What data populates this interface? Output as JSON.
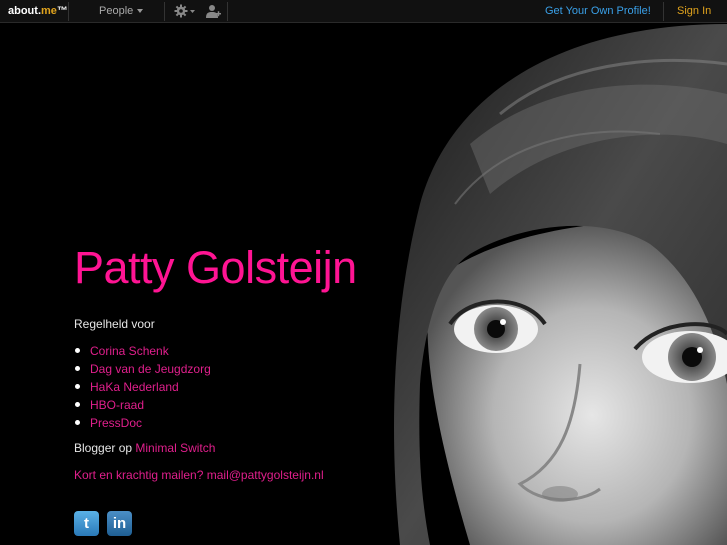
{
  "topbar": {
    "logo_main": "about.",
    "logo_accent": "me",
    "logo_tm": "™",
    "people_label": "People",
    "get_profile": "Get Your Own Profile!",
    "sign_in": "Sign In"
  },
  "profile": {
    "name": "Patty Golsteijn",
    "intro": "Regelheld voor",
    "links": [
      "Corina Schenk",
      "Dag van de Jeugdzorg",
      "HaKa Nederland",
      "HBO-raad",
      "PressDoc"
    ],
    "blogger_prefix": "Blogger op ",
    "blogger_link": "Minimal Switch",
    "mail": "Kort en krachtig mailen? mail@pattygolsteijn.nl"
  },
  "social": {
    "twitter_glyph": "t",
    "linkedin_glyph": "in"
  },
  "colors": {
    "name": "#ff1493",
    "link": "#e01f8c",
    "sign_in": "#e0a31d",
    "get_profile": "#3aa0e8"
  }
}
